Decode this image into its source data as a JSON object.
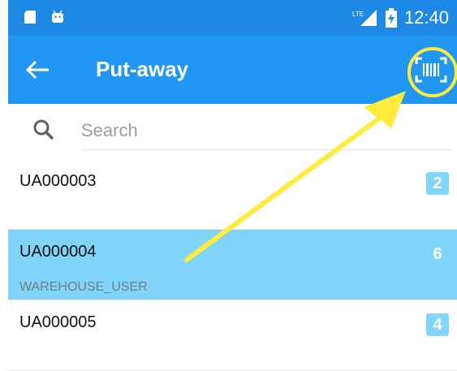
{
  "status_bar": {
    "network_label": "LTE",
    "time": "12:40"
  },
  "app_bar": {
    "title": "Put-away"
  },
  "search": {
    "placeholder": "Search"
  },
  "list": {
    "items": [
      {
        "title": "UA000003",
        "subtitle": "",
        "count": "2"
      },
      {
        "title": "UA000004",
        "subtitle": "WAREHOUSE_USER",
        "count": "6"
      },
      {
        "title": "UA000005",
        "subtitle": "",
        "count": "4"
      }
    ]
  },
  "colors": {
    "status_bar": "#1e88e5",
    "app_bar": "#2196f3",
    "selected_row": "#80d4fa",
    "badge": "#81d4fa",
    "annotation": "#ffeb3b"
  },
  "icons": [
    "sd-card-icon",
    "android-icon",
    "signal-icon",
    "battery-charging-icon",
    "back-arrow-icon",
    "barcode-scan-icon",
    "search-icon"
  ]
}
